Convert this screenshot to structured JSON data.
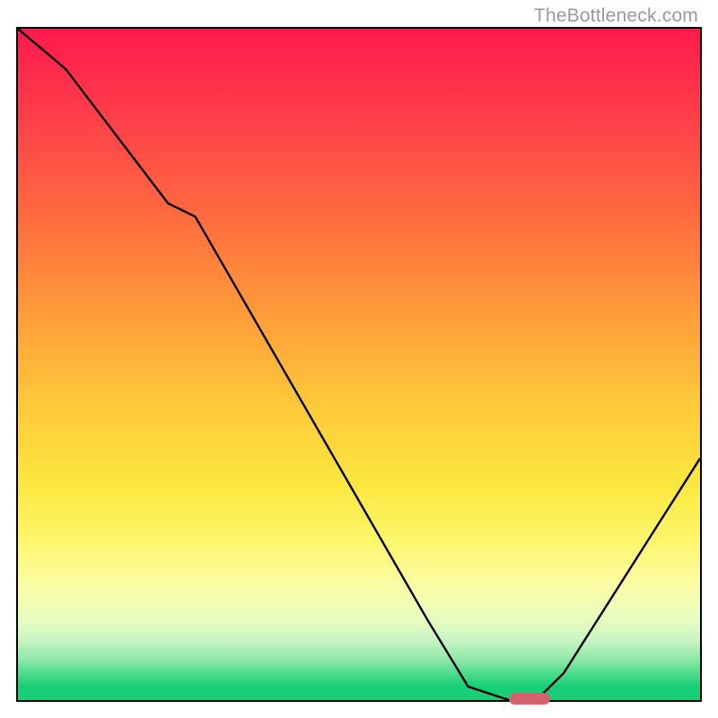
{
  "watermark": "TheBottleneck.com",
  "chart_data": {
    "type": "line",
    "title": "",
    "xlabel": "",
    "ylabel": "",
    "xlim": [
      0,
      100
    ],
    "ylim": [
      0,
      100
    ],
    "x": [
      0,
      7,
      22,
      26,
      60,
      66,
      72,
      76,
      80,
      100
    ],
    "values": [
      100,
      94,
      74,
      72,
      12,
      2,
      0,
      0,
      4,
      36
    ],
    "marker": {
      "x_start": 72,
      "x_end": 78,
      "y": 0
    },
    "background_gradient": {
      "stops": [
        {
          "pos": 0.0,
          "color": "#ff1a4d"
        },
        {
          "pos": 0.28,
          "color": "#ff6b3f"
        },
        {
          "pos": 0.56,
          "color": "#ffc93a"
        },
        {
          "pos": 0.76,
          "color": "#fdf66a"
        },
        {
          "pos": 0.91,
          "color": "#c9f5c3"
        },
        {
          "pos": 1.0,
          "color": "#18cf78"
        }
      ]
    }
  }
}
